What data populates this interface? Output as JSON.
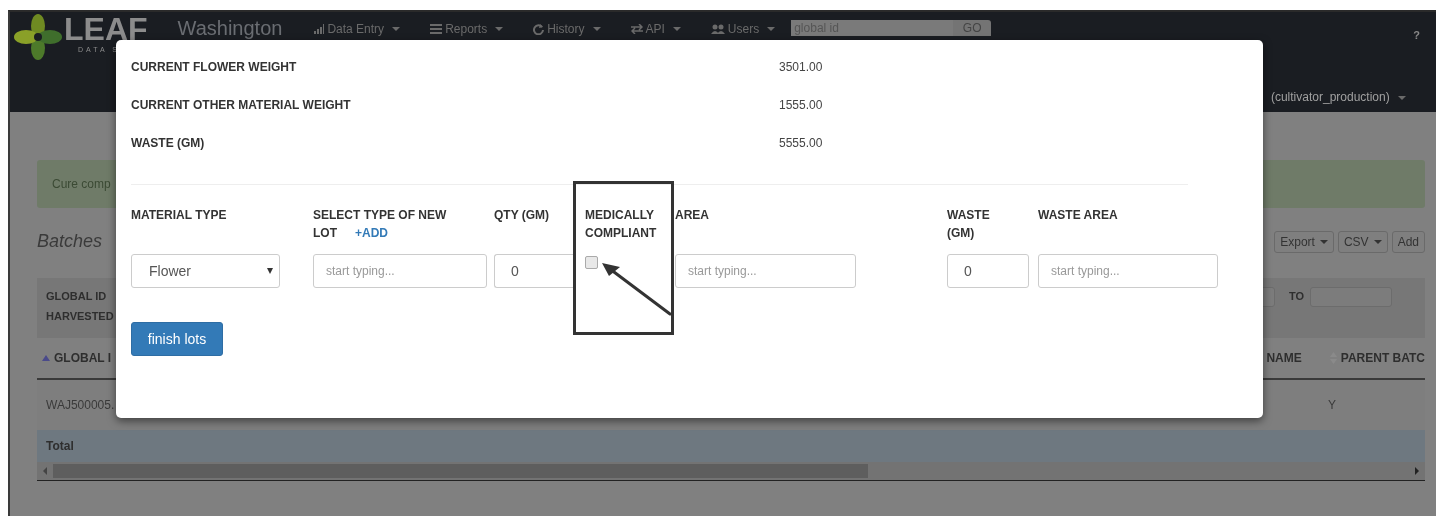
{
  "navbar": {
    "logo": "LEAF",
    "logo_sub": "DATA S",
    "region": "Washington",
    "menus": [
      {
        "label": "Data Entry",
        "kind": "chart"
      },
      {
        "label": "Reports",
        "kind": "list"
      },
      {
        "label": "History",
        "kind": "history"
      },
      {
        "label": "API",
        "kind": "swap"
      },
      {
        "label": "Users",
        "kind": "users"
      }
    ],
    "search": {
      "placeholder": "global id",
      "button": "GO"
    },
    "help": "?",
    "user": "(cultivator_production)"
  },
  "page": {
    "alert": "Cure comp",
    "title": "Batches",
    "actions": [
      {
        "label": "Export",
        "kind": "dropdown"
      },
      {
        "label": "CSV",
        "kind": "dropdown"
      },
      {
        "label": "Add",
        "kind": "button"
      }
    ],
    "filters": {
      "labels": [
        "GLOBAL ID",
        "HARVESTED"
      ],
      "to": "TO"
    },
    "table": {
      "columns": [
        {
          "label": "GLOBAL I",
          "kind": "sorted"
        },
        {
          "label": "NAME",
          "kind": "plain"
        },
        {
          "label": "PARENT BATC",
          "kind": "sortable"
        }
      ],
      "rows": [
        {
          "cells": [
            "WAJ500005.",
            "Y"
          ]
        }
      ],
      "total": "Total"
    }
  },
  "modal": {
    "summary": [
      {
        "label": "CURRENT FLOWER WEIGHT",
        "value": "3501.00"
      },
      {
        "label": "CURRENT OTHER MATERIAL WEIGHT",
        "value": "1555.00"
      },
      {
        "label": "WASTE (GM)",
        "value": "5555.00"
      }
    ],
    "fields": [
      {
        "kind": "select",
        "label": "MATERIAL TYPE",
        "value": "Flower"
      },
      {
        "kind": "text",
        "label": "SELECT TYPE OF NEW LOT",
        "link": "+ADD",
        "placeholder": "start typing..."
      },
      {
        "kind": "number",
        "label": "QTY (GM)",
        "value": "0"
      },
      {
        "kind": "checkbox",
        "label": "MEDICALLY COMPLIANT",
        "checked": false,
        "highlighted": true
      },
      {
        "kind": "text",
        "label": "AREA",
        "placeholder": "start typing..."
      },
      {
        "kind": "number",
        "label": "WASTE (GM)",
        "value": "0"
      },
      {
        "kind": "text",
        "label": "WASTE AREA",
        "placeholder": "start typing..."
      }
    ],
    "button": "finish lots"
  }
}
